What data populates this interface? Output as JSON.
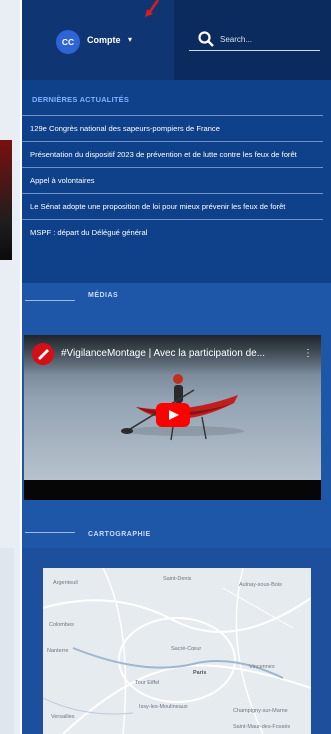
{
  "header": {
    "avatar_initials": "CC",
    "account_label": "Compte",
    "caret": "▾",
    "search_placeholder": "Search...",
    "colors": {
      "bar": "#0f3572",
      "search_block": "#0b2a5e",
      "avatar": "#2f64d4",
      "arrow": "#d61f1f"
    }
  },
  "news": {
    "title": "DERNIÈRES ACTUALITÉS",
    "items": [
      "129e Congrès national des sapeurs-pompiers de France",
      "Présentation du dispositif 2023 de prévention et de lutte contre les feux de forêt",
      "Appel à volontaires",
      "Le Sénat adopte une proposition de loi pour mieux prévenir les feux de forêt",
      "MSPF : départ du Délégué général"
    ]
  },
  "media": {
    "title": "MÉDIAS",
    "video": {
      "title": "#VigilanceMontage | Avec la participation de...",
      "menu": "⋮"
    }
  },
  "carto": {
    "title": "CARTOGRAPHIE",
    "map_labels": [
      "Argenteuil",
      "Saint-Denis",
      "Aulnay-sous-Bois",
      "Colombes",
      "Nanterre",
      "Sacré-Cœur",
      "Tour Eiffel",
      "Paris",
      "Vincennes",
      "Versailles",
      "Issy-les-Moulineaux",
      "Champigny-sur-Marne",
      "Saint-Maur-des-Fossés"
    ]
  }
}
